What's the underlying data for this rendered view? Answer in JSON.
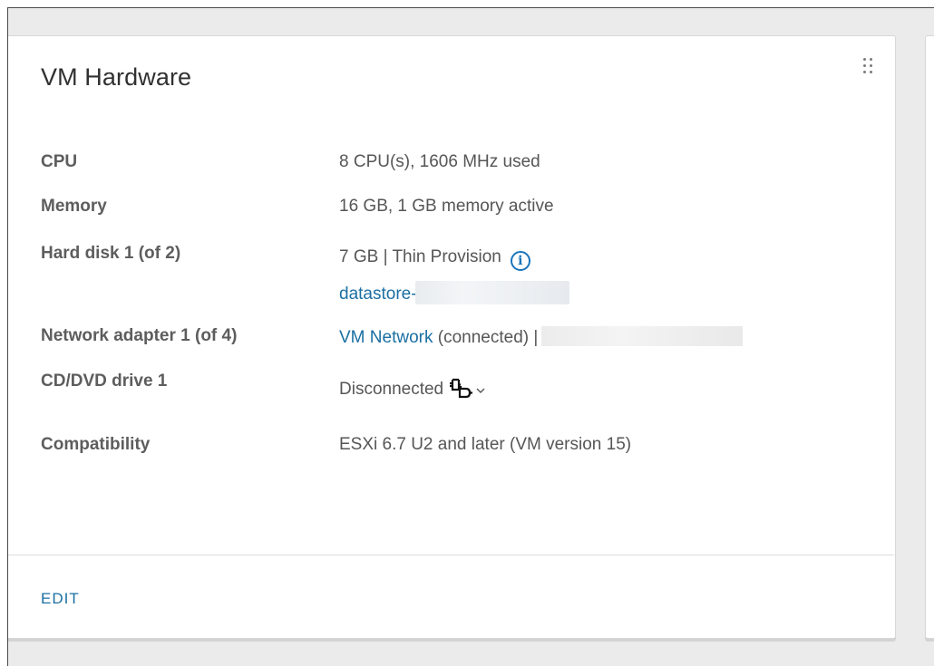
{
  "card": {
    "title": "VM Hardware",
    "drag_handle_icon": "grip-dots-icon",
    "edit_label": "EDIT"
  },
  "properties": {
    "cpu": {
      "label": "CPU",
      "value": "8 CPU(s), 1606 MHz used"
    },
    "memory": {
      "label": "Memory",
      "value": "16 GB, 1 GB memory active"
    },
    "hard_disk": {
      "label": "Hard disk 1 (of 2)",
      "value": "7 GB | Thin Provision",
      "info_icon": "info-icon",
      "datastore_link": "datastore-"
    },
    "network_adapter": {
      "label": "Network adapter 1 (of 4)",
      "network_link": "VM Network",
      "status": "(connected) |"
    },
    "cd_dvd": {
      "label": "CD/DVD drive 1",
      "value": "Disconnected",
      "connect_icon": "plug-disconnected-icon",
      "dropdown_icon": "chevron-down-icon"
    },
    "compatibility": {
      "label": "Compatibility",
      "value": "ESXi 6.7 U2 and later (VM version 15)"
    }
  },
  "colors": {
    "link": "#1b6fa3",
    "info_icon": "#1b75bb",
    "label": "#5d5d5d",
    "title": "#313131"
  }
}
